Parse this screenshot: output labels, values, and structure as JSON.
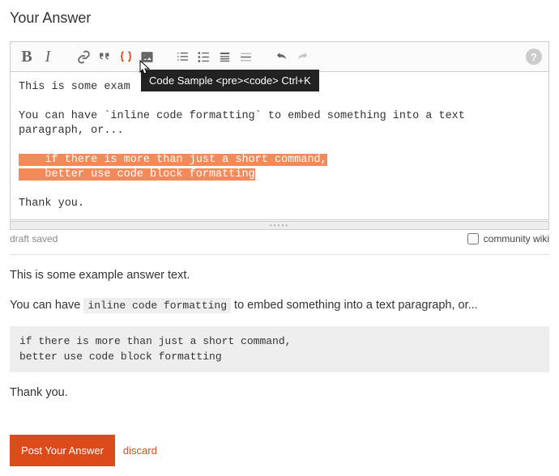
{
  "heading": "Your Answer",
  "toolbar": {
    "tooltip": "Code Sample <pre><code> Ctrl+K",
    "help_char": "?"
  },
  "editor": {
    "line1": "This is some exam",
    "line2": "You can have `inline code formatting` to embed something into a text",
    "line3": "paragraph, or...",
    "hl1": "    if there is more than just a short command,",
    "hl2": "    better use code block formatting",
    "line4": "Thank you."
  },
  "status": {
    "draft": "draft saved",
    "wiki_label": "community wiki"
  },
  "preview": {
    "p1": "This is some example answer text.",
    "p2a": "You can have ",
    "p2code": "inline code formatting",
    "p2b": " to embed something into a text paragraph, or...",
    "block": "if there is more than just a short command,\nbetter use code block formatting",
    "p3": "Thank you."
  },
  "actions": {
    "post": "Post Your Answer",
    "discard": "discard"
  }
}
